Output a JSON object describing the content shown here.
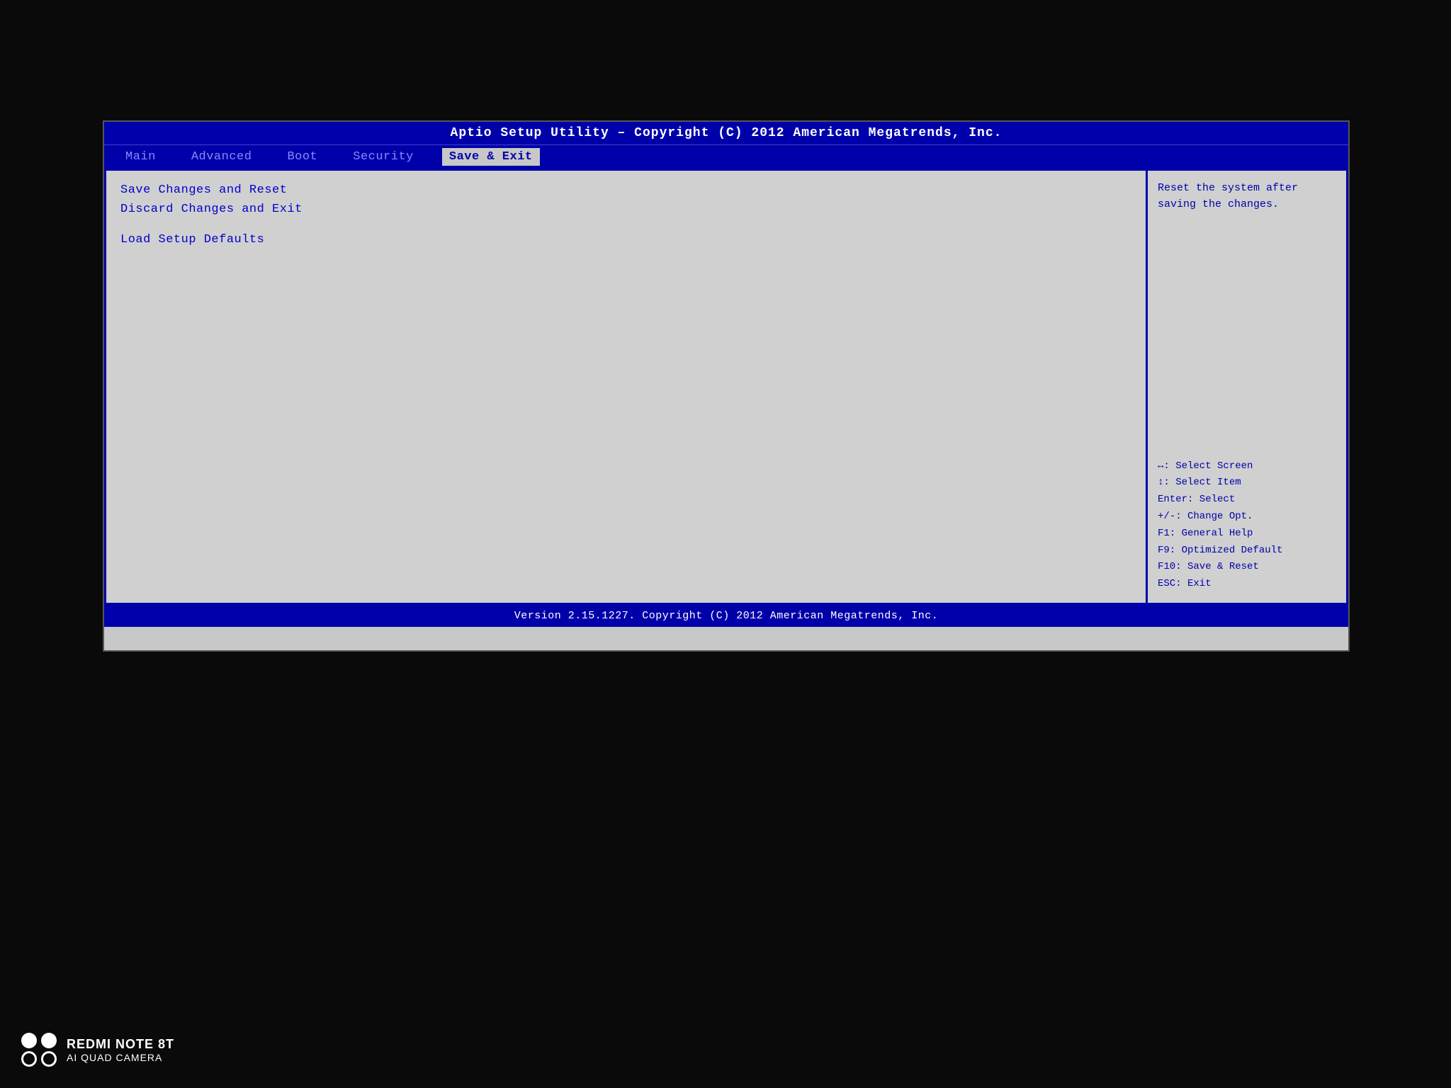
{
  "bios": {
    "title": "Aptio Setup Utility – Copyright (C) 2012 American Megatrends, Inc.",
    "footer": "Version 2.15.1227. Copyright (C) 2012 American Megatrends, Inc.",
    "menu": {
      "items": [
        {
          "id": "main",
          "label": "Main",
          "active": false
        },
        {
          "id": "advanced",
          "label": "Advanced",
          "active": false
        },
        {
          "id": "boot",
          "label": "Boot",
          "active": false
        },
        {
          "id": "security",
          "label": "Security",
          "active": false
        },
        {
          "id": "save-exit",
          "label": "Save & Exit",
          "active": true
        }
      ]
    },
    "options": [
      {
        "id": "save-changes-reset",
        "label": "Save Changes and Reset",
        "selected": false
      },
      {
        "id": "discard-changes-exit",
        "label": "Discard Changes and Exit",
        "selected": false
      },
      {
        "id": "load-setup-defaults",
        "label": "Load Setup Defaults",
        "selected": false
      }
    ],
    "help": {
      "description": "Reset the system after saving the changes.",
      "keys": [
        "↔: Select Screen",
        "↕: Select Item",
        "Enter: Select",
        "+/-: Change Opt.",
        "F1: General Help",
        "F9: Optimized Default",
        "F10: Save & Reset",
        "ESC: Exit"
      ]
    }
  },
  "phone": {
    "model": "REDMI NOTE 8T",
    "camera": "AI QUAD CAMERA"
  }
}
